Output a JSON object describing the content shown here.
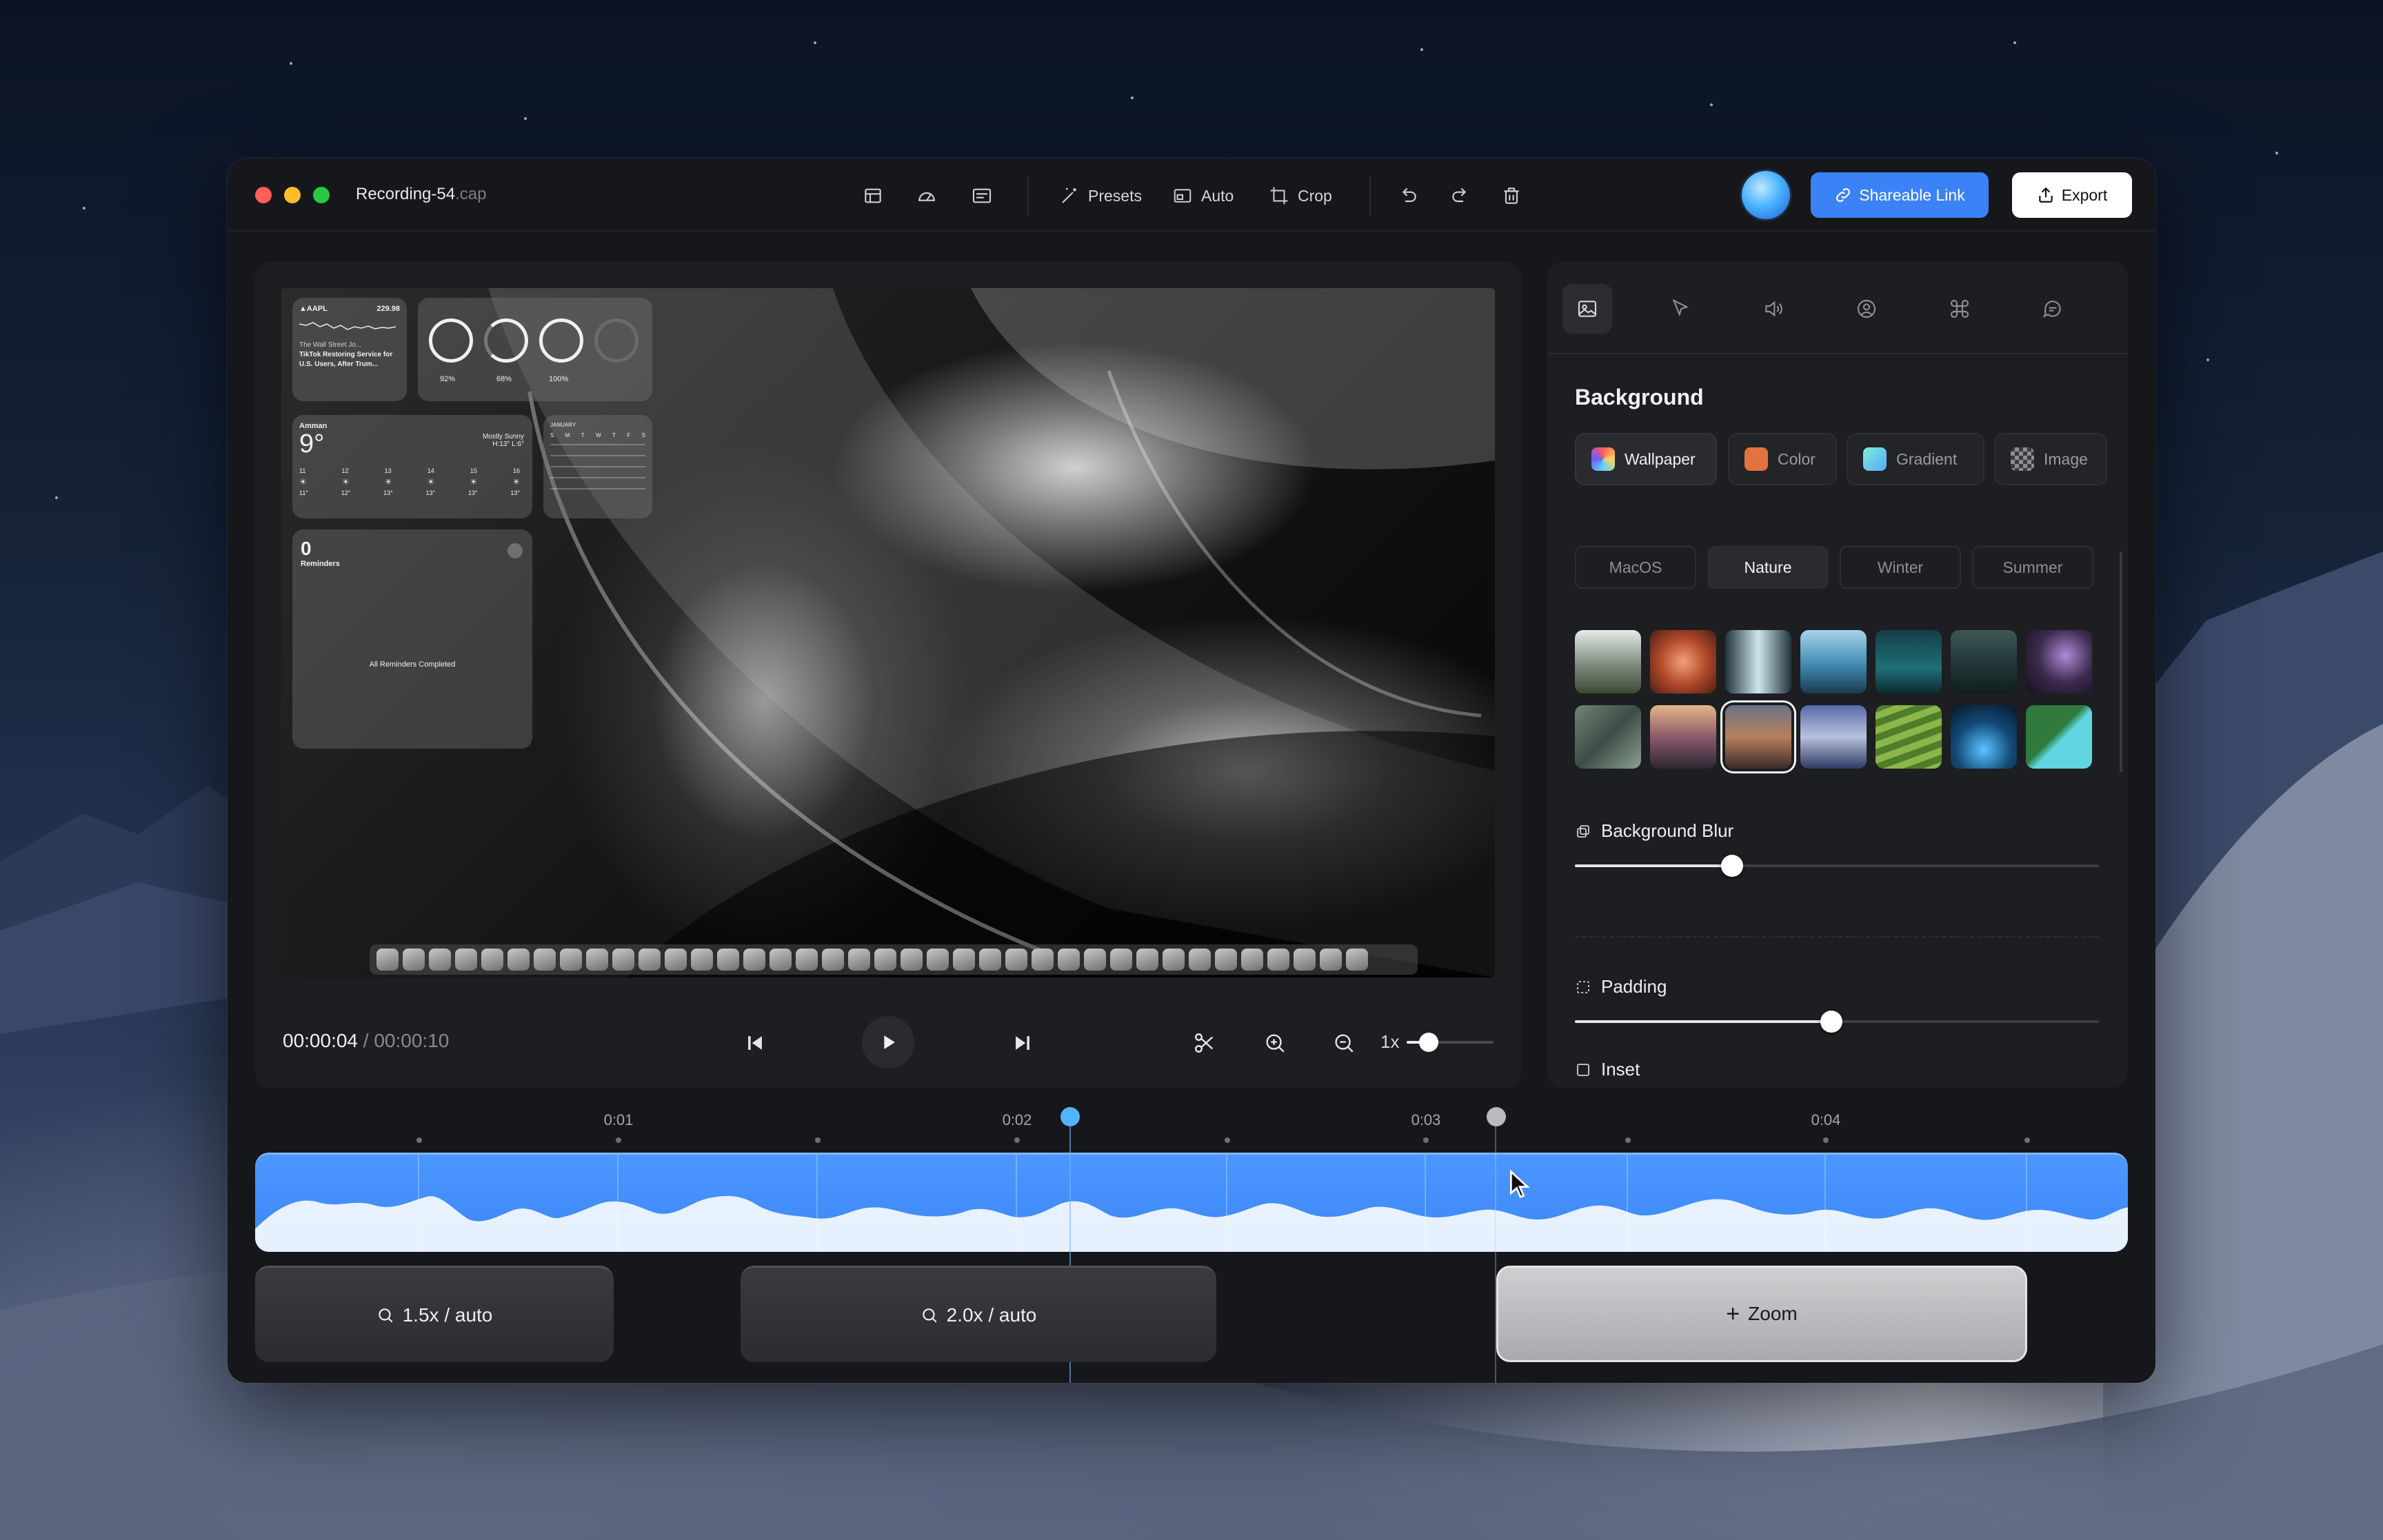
{
  "window": {
    "title": "Recording-54",
    "title_ext": ".cap"
  },
  "toolbar": {
    "presets_label": "Presets",
    "auto_label": "Auto",
    "crop_label": "Crop",
    "share_label": "Shareable Link",
    "export_label": "Export"
  },
  "preview": {
    "stock": {
      "symbol": "▲AAPL",
      "price": "229.98",
      "news_source": "The Wall Street Jo...",
      "news_headline": "TikTok Restoring Service for U.S. Users, After Trum..."
    },
    "batteries": [
      "92%",
      "68%",
      "100%"
    ],
    "weather": {
      "city": "Amman",
      "temp": "9°",
      "condition": "Mostly Sunny",
      "range": "H:13° L:6°",
      "hours": [
        "11",
        "12",
        "13",
        "14",
        "15",
        "16"
      ],
      "temps": [
        "11°",
        "12°",
        "13°",
        "13°",
        "13°",
        "13°"
      ]
    },
    "calendar": {
      "month": "JANUARY",
      "days": [
        "S",
        "M",
        "T",
        "W",
        "T",
        "F",
        "S"
      ]
    },
    "reminders": {
      "count": "0",
      "label": "Reminders",
      "status": "All Reminders Completed"
    }
  },
  "playback": {
    "current_time": "00:00:04",
    "separator": "/",
    "total_time": "00:00:10",
    "speed_label": "1x"
  },
  "settings": {
    "section_title": "Background",
    "bg_types": [
      "Wallpaper",
      "Color",
      "Gradient",
      "Image"
    ],
    "categories": [
      "MacOS",
      "Nature",
      "Winter",
      "Summer"
    ],
    "active_category": "Nature",
    "background_blur_label": "Background Blur",
    "background_blur_value": 0.3,
    "padding_label": "Padding",
    "padding_value": 0.49,
    "inset_label": "Inset"
  },
  "timeline": {
    "ruler_labels": [
      "0:01",
      "0:02",
      "0:03",
      "0:04"
    ],
    "zoom_segments": [
      "1.5x / auto",
      "2.0x / auto"
    ],
    "add_zoom_label": "Zoom"
  },
  "colors": {
    "accent": "#3b82f6",
    "playhead": "#52b4ff",
    "clip": "#4c97ff"
  }
}
